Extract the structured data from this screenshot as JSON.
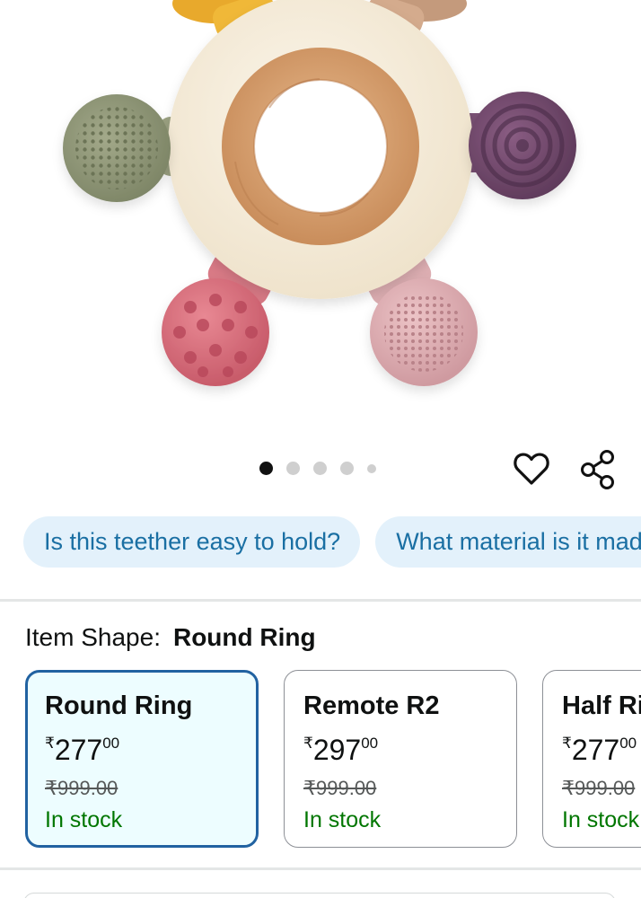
{
  "gallery": {
    "dot_count": 5,
    "active_index": 0
  },
  "questions": [
    "Is this teether easy to hold?",
    "What material is it made of?"
  ],
  "item_shape": {
    "label": "Item Shape:",
    "selected": "Round Ring"
  },
  "variants": [
    {
      "title": "Round Ring",
      "currency": "₹",
      "price_whole": "277",
      "price_fraction": "00",
      "mrp": "₹999.00",
      "stock": "In stock",
      "selected": true
    },
    {
      "title": "Remote R2",
      "currency": "₹",
      "price_whole": "297",
      "price_fraction": "00",
      "mrp": "₹999.00",
      "stock": "In stock",
      "selected": false
    },
    {
      "title": "Half Ring",
      "currency": "₹",
      "price_whole": "277",
      "price_fraction": "00",
      "mrp": "₹999.00",
      "stock": "In stock",
      "selected": false
    }
  ],
  "icons": {
    "wishlist": "heart-outline-icon",
    "share": "share-icon"
  },
  "colors": {
    "chip_bg": "#e3f1fb",
    "chip_text": "#1a6fa3",
    "selected_border": "#2162a1",
    "selected_bg": "#edfdff",
    "in_stock": "#007600",
    "mrp_text": "#565959"
  }
}
